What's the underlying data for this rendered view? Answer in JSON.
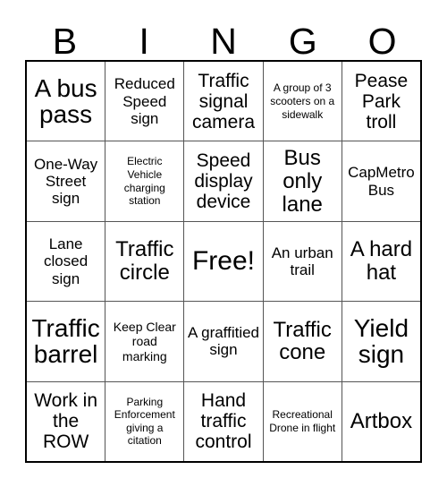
{
  "card": {
    "title": "BINGO",
    "header_letters": [
      "B",
      "I",
      "N",
      "G",
      "O"
    ],
    "free_space": {
      "label": "Free!",
      "row": 2,
      "col": 2
    },
    "grid": {
      "rows": 5,
      "cols": 5,
      "cells": [
        [
          {
            "text": "A bus pass",
            "size": "xxl"
          },
          {
            "text": "Reduced Speed sign",
            "size": "md"
          },
          {
            "text": "Traffic signal camera",
            "size": "lg"
          },
          {
            "text": "A group of 3 scooters on a sidewalk",
            "size": "xs"
          },
          {
            "text": "Pease Park troll",
            "size": "lg"
          }
        ],
        [
          {
            "text": "One-Way Street sign",
            "size": "md"
          },
          {
            "text": "Electric Vehicle charging station",
            "size": "xs"
          },
          {
            "text": "Speed display device",
            "size": "lg"
          },
          {
            "text": "Bus only lane",
            "size": "xl"
          },
          {
            "text": "CapMetro Bus",
            "size": "md"
          }
        ],
        [
          {
            "text": "Lane closed sign",
            "size": "md"
          },
          {
            "text": "Traffic circle",
            "size": "xl"
          },
          {
            "text": "Free!",
            "size": "free"
          },
          {
            "text": "An urban trail",
            "size": "md"
          },
          {
            "text": "A hard hat",
            "size": "xl"
          }
        ],
        [
          {
            "text": "Traffic barrel",
            "size": "xxl"
          },
          {
            "text": "Keep Clear road marking",
            "size": "sm"
          },
          {
            "text": "A graffitied sign",
            "size": "md"
          },
          {
            "text": "Traffic cone",
            "size": "xl"
          },
          {
            "text": "Yield sign",
            "size": "xxl"
          }
        ],
        [
          {
            "text": "Work in the ROW",
            "size": "lg"
          },
          {
            "text": "Parking Enforcement giving a citation",
            "size": "xs"
          },
          {
            "text": "Hand traffic control",
            "size": "lg"
          },
          {
            "text": "Recreational Drone in flight",
            "size": "xs"
          },
          {
            "text": "Artbox",
            "size": "xl"
          }
        ]
      ]
    },
    "colors": {
      "background": "#ffffff",
      "text": "#000000",
      "outer_border": "#000000",
      "inner_border": "#555555"
    }
  }
}
